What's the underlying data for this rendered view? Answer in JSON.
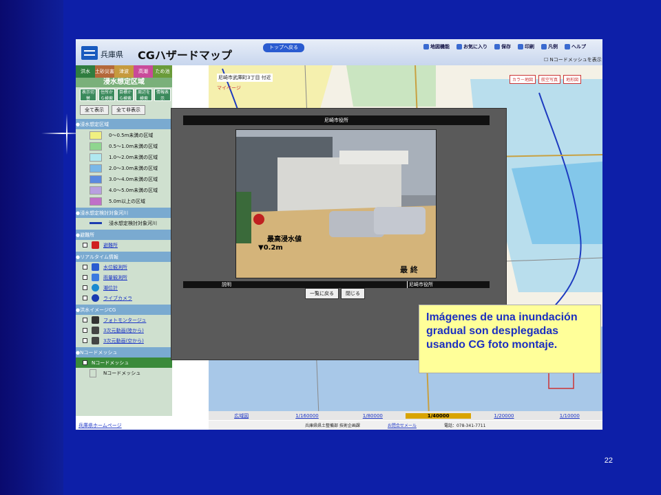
{
  "slide": {
    "page_number": "22"
  },
  "app": {
    "prefecture": "兵庫県",
    "title": "CGハザードマップ",
    "top_button": "トップへ戻る",
    "menu": [
      "地図機能",
      "お気に入り",
      "保存",
      "印刷",
      "凡例",
      "ヘルプ"
    ],
    "nmesh_toggle": "Nコードメッシュを表示"
  },
  "sidebar": {
    "tabs": [
      {
        "label": "洪水",
        "color": "#2f7d3f"
      },
      {
        "label": "土砂災害",
        "color": "#b4683a"
      },
      {
        "label": "津波",
        "color": "#c69a3e"
      },
      {
        "label": "高潮",
        "color": "#c94a9a"
      },
      {
        "label": "ため池",
        "color": "#6a9b3a"
      }
    ],
    "section_title": "浸水想定区域",
    "sub_buttons": [
      "表示切替",
      "住所から検索",
      "目標から検索",
      "周辺を検索",
      "情報表示"
    ],
    "show_all": "全て表示",
    "hide_all": "全て非表示",
    "legend_header": "浸水想定区域",
    "depth_rows": [
      {
        "label": "0〜0.5m未満の区域",
        "color": "#f0f080"
      },
      {
        "label": "0.5〜1.0m未満の区域",
        "color": "#8fd68f"
      },
      {
        "label": "1.0〜2.0m未満の区域",
        "color": "#b0e8f0"
      },
      {
        "label": "2.0〜3.0m未満の区域",
        "color": "#7ab8e8"
      },
      {
        "label": "3.0〜4.0m未満の区域",
        "color": "#5a8ae0"
      },
      {
        "label": "4.0〜5.0m未満の区域",
        "color": "#b8a0e0"
      },
      {
        "label": "5.0m以上の区域",
        "color": "#c070c8"
      }
    ],
    "river_header": "浸水想定検討対象河川",
    "river_item": "浸水想定検討対象河川",
    "shelter_header": "避難所",
    "shelter_item": "避難所",
    "realtime_header": "リアルタイム情報",
    "realtime_items": [
      "水位観測所",
      "雨量観測所",
      "潮位計",
      "ライブカメラ"
    ],
    "cg_header": "洪水イメージCG",
    "cg_items": [
      "フォトモンタージュ",
      "3次元動画(陸から)",
      "3次元動画(空から)"
    ],
    "nmesh_header": "Nコードメッシュ",
    "nmesh_items": [
      "Nコードメッシュ",
      "Nコードメッシュ"
    ],
    "home_link": "兵庫県ホームページ"
  },
  "map": {
    "address": "尼崎市武庫町3丁目 付近",
    "my_page": "マイページ",
    "view_buttons": [
      "カラー地図",
      "航空写真",
      "地形図"
    ],
    "scales": [
      "広域図",
      "1/160000",
      "1/80000",
      "1/40000",
      "1/20000",
      "1/10000"
    ],
    "selected_scale": "1/40000",
    "footer_org": "兵庫県県土整備部 技術企画課",
    "footer_contact": "お問合せメール",
    "footer_phone": "電話：078-341-7711"
  },
  "popup": {
    "title": "尼崎市役所",
    "photo_caption": "最高浸水値",
    "photo_depth": "▼0.2m",
    "photo_stamp": "最 終",
    "desc_label": "説明",
    "desc_value": "尼崎市役所",
    "back_button": "一覧に戻る",
    "close_button": "閉じる"
  },
  "callout": {
    "text": "Imágenes de una inundación gradual son desplegadas usando CG foto montaje."
  }
}
